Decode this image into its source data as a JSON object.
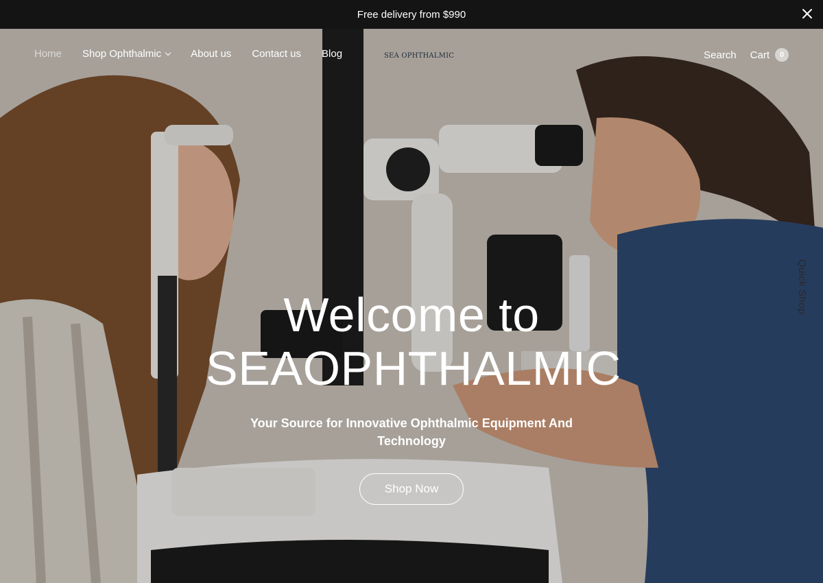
{
  "announcement": {
    "text": "Free delivery from $990"
  },
  "nav": {
    "items": [
      {
        "label": "Home"
      },
      {
        "label": "Shop Ophthalmic"
      },
      {
        "label": "About us"
      },
      {
        "label": "Contact us"
      },
      {
        "label": "Blog"
      }
    ]
  },
  "logo": {
    "text": "SEA OPHTHALMIC"
  },
  "header_right": {
    "search_label": "Search",
    "cart_label": "Cart",
    "cart_count": "0"
  },
  "hero": {
    "title_line1": "Welcome to",
    "title_line2": "SEAOPHTHALMIC",
    "subtitle": "Your Source for Innovative Ophthalmic Equipment And Technology",
    "cta_label": "Shop Now"
  },
  "quick_shop": {
    "label": "Quick Shop"
  },
  "colors": {
    "announcement_bg": "#141414",
    "text_light": "#ffffff",
    "scrubs": "#2f4a72"
  }
}
